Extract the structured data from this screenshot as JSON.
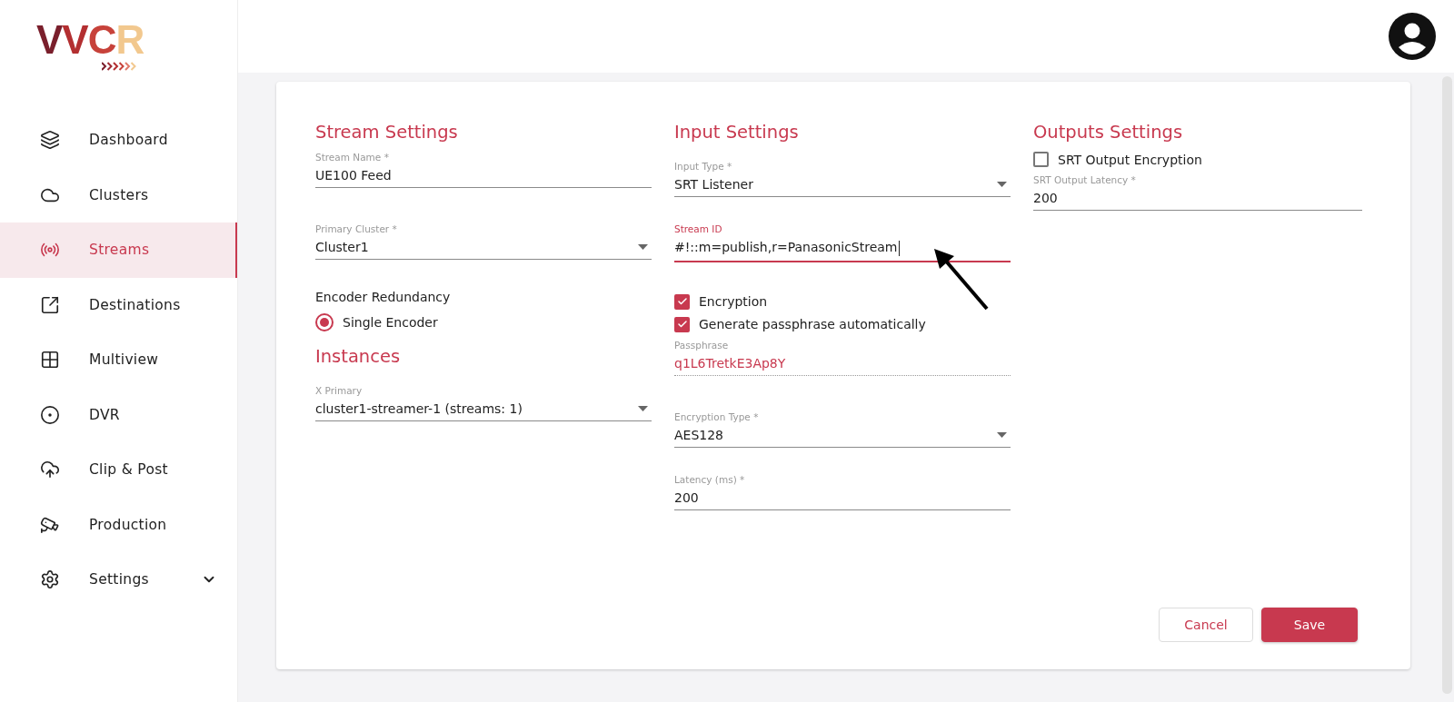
{
  "logo": {
    "letters": [
      {
        "char": "V",
        "color": "#7a1f2c"
      },
      {
        "char": "V",
        "color": "#b32f31"
      },
      {
        "char": "C",
        "color": "#c7423a"
      },
      {
        "char": "R",
        "color": "#f2c88e"
      }
    ]
  },
  "sidebar": {
    "items": [
      {
        "label": "Dashboard",
        "selected": false
      },
      {
        "label": "Clusters",
        "selected": false
      },
      {
        "label": "Streams",
        "selected": true
      },
      {
        "label": "Destinations",
        "selected": false
      },
      {
        "label": "Multiview",
        "selected": false
      },
      {
        "label": "DVR",
        "selected": false
      },
      {
        "label": "Clip & Post",
        "selected": false
      },
      {
        "label": "Production",
        "selected": false
      },
      {
        "label": "Settings",
        "selected": false,
        "expanded": false
      }
    ]
  },
  "form": {
    "columns": [
      {
        "items": [
          {
            "kind": "heading",
            "text": "Stream Settings"
          },
          {
            "kind": "text",
            "label": "Stream Name *",
            "value": "UE100 Feed"
          },
          {
            "kind": "select",
            "label": "Primary Cluster *",
            "value": "Cluster1"
          },
          {
            "kind": "group",
            "text": "Encoder Redundancy"
          },
          {
            "kind": "radio",
            "label": "Single Encoder",
            "selected": true
          },
          {
            "kind": "heading",
            "text": "Instances"
          },
          {
            "kind": "select",
            "label": "X Primary",
            "value": "cluster1-streamer-1 (streams: 1)"
          }
        ]
      },
      {
        "items": [
          {
            "kind": "heading",
            "text": "Input Settings"
          },
          {
            "kind": "select",
            "label": "Input Type *",
            "value": "SRT Listener"
          },
          {
            "kind": "text",
            "label": "Stream ID",
            "value": "#!::m=publish,r=PanasonicStream",
            "focused": true
          },
          {
            "kind": "checkbox",
            "label": "Encryption",
            "checked": true
          },
          {
            "kind": "checkbox",
            "label": "Generate passphrase automatically",
            "checked": true
          },
          {
            "kind": "readonly",
            "label": "Passphrase",
            "value": "q1L6TretkE3Ap8Y"
          },
          {
            "kind": "select",
            "label": "Encryption Type *",
            "value": "AES128"
          },
          {
            "kind": "text",
            "label": "Latency (ms) *",
            "value": "200"
          }
        ]
      },
      {
        "items": [
          {
            "kind": "heading",
            "text": "Outputs Settings"
          },
          {
            "kind": "checkbox",
            "label": "SRT Output Encryption",
            "checked": false
          },
          {
            "kind": "text",
            "label": "SRT Output Latency *",
            "value": "200"
          }
        ]
      }
    ]
  },
  "buttons": [
    {
      "label": "Cancel",
      "kind": "secondary"
    },
    {
      "label": "Save",
      "kind": "primary"
    }
  ]
}
